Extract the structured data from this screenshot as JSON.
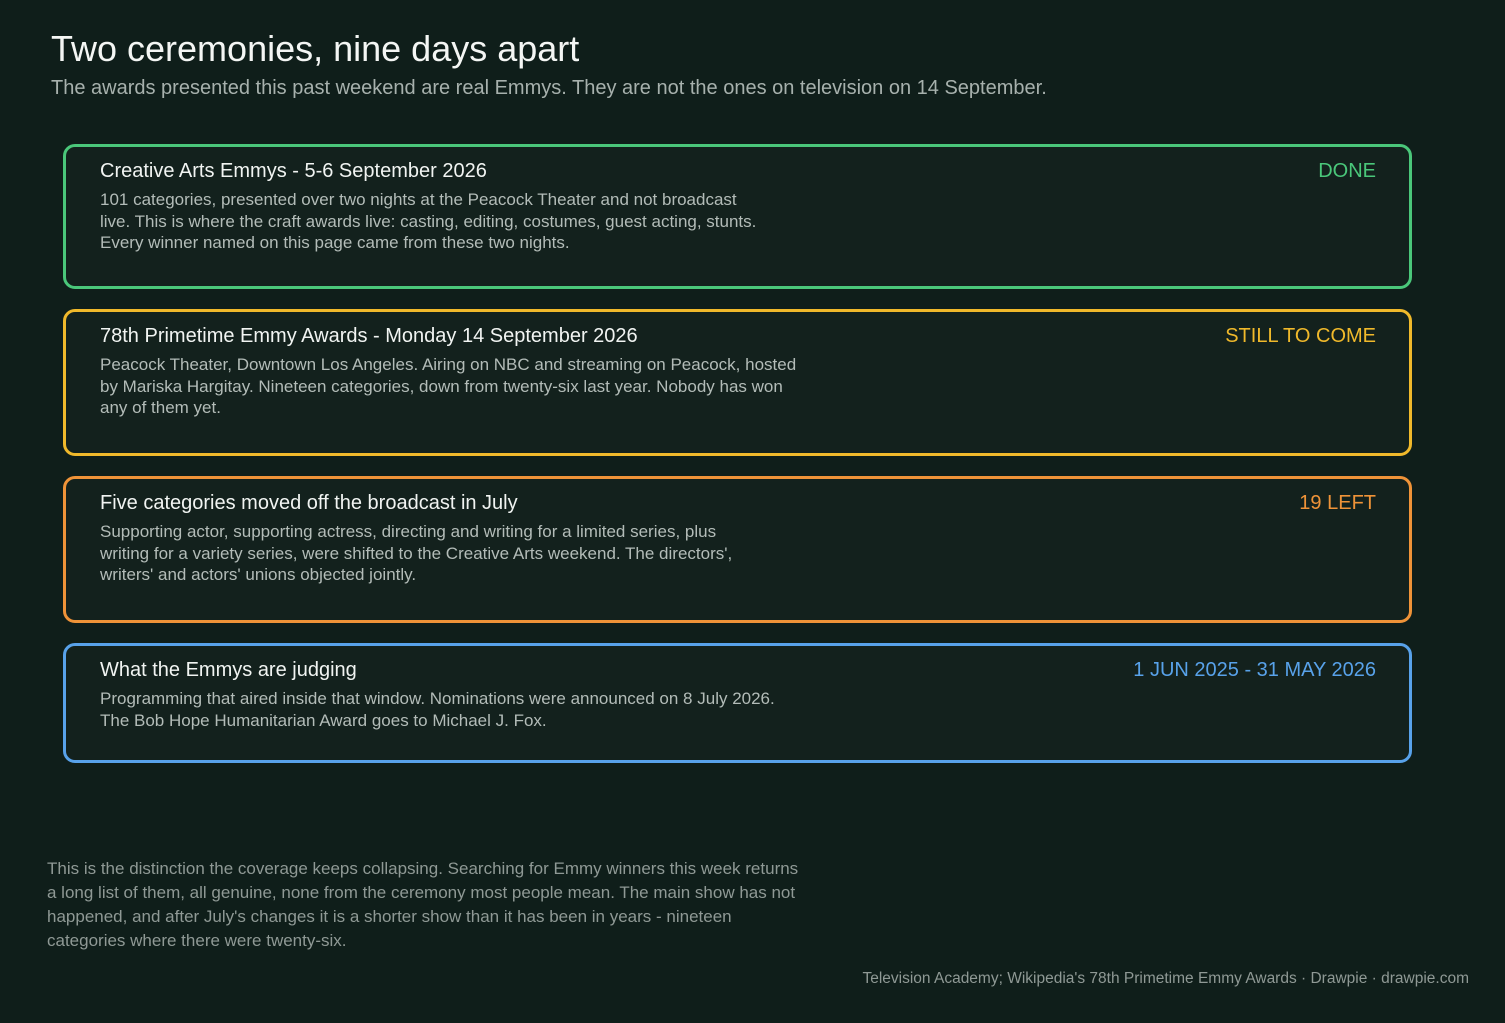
{
  "header": {
    "title": "Two ceremonies, nine days apart",
    "subtitle": "The awards presented this past weekend are real Emmys. They are not the ones on television on 14 September."
  },
  "cards": [
    {
      "title": "Creative Arts Emmys - 5-6 September 2026",
      "status": "DONE",
      "color": "#4ac77a",
      "body": "101 categories, presented over two nights at the Peacock Theater and not broadcast live. This is where the craft awards live: casting, editing, costumes, guest acting, stunts. Every winner named on this page came from these two nights."
    },
    {
      "title": "78th Primetime Emmy Awards - Monday 14 September 2026",
      "status": "STILL TO COME",
      "color": "#f0b92b",
      "body": "Peacock Theater, Downtown Los Angeles. Airing on NBC and streaming on Peacock, hosted by Mariska Hargitay. Nineteen categories, down from twenty-six last year. Nobody has won any of them yet."
    },
    {
      "title": "Five categories moved off the broadcast in July",
      "status": "19 LEFT",
      "color": "#ef9338",
      "body": "Supporting actor, supporting actress, directing and writing for a limited series, plus writing for a variety series, were shifted to the Creative Arts weekend. The directors', writers' and actors' unions objected jointly."
    },
    {
      "title": "What the Emmys are judging",
      "status": "1 JUN 2025 - 31 MAY 2026",
      "color": "#58a2ea",
      "body": "Programming that aired inside that window. Nominations were announced on 8 July 2026. The Bob Hope Humanitarian Award goes to Michael J. Fox."
    }
  ],
  "footer": {
    "note": "This is the distinction the coverage keeps collapsing. Searching for Emmy winners this week returns a long list of them, all genuine, none from the ceremony most people mean. The main show has not happened, and after July's changes it is a shorter show than it has been in years - nineteen categories where there were twenty-six.",
    "source": "Television Academy; Wikipedia's 78th Primetime Emmy Awards  ·  Drawpie · drawpie.com"
  }
}
